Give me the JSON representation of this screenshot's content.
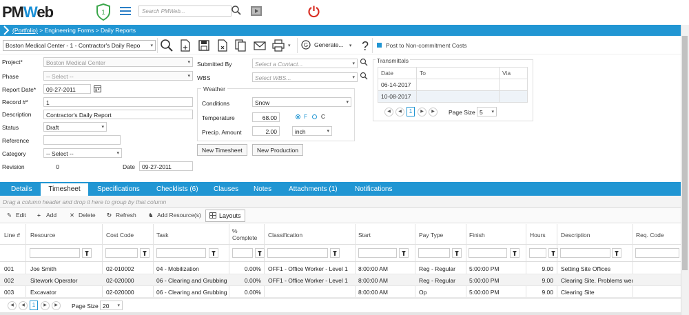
{
  "header": {
    "logo_main": "PM",
    "logo_w": "W",
    "logo_rest": "eb",
    "badge_count": "1",
    "search_placeholder": "Search PMWeb...",
    "colors": {
      "accent": "#2196d3",
      "power": "#d93025"
    }
  },
  "breadcrumb": {
    "root": "(Portfolio)",
    "path": " > Engineering Forms > Daily Reports"
  },
  "toolbar": {
    "project_selected": "Boston Medical Center - 1 - Contractor's Daily Repo",
    "generate_label": "Generate...",
    "post_label": "Post to Non-commitment Costs",
    "icons": [
      "search-icon",
      "new-icon",
      "save-icon",
      "delete-icon",
      "copy-icon",
      "email-icon",
      "print-icon",
      "generate-icon",
      "help-icon"
    ]
  },
  "form": {
    "project_label": "Project*",
    "project_value": "Boston Medical Center",
    "phase_label": "Phase",
    "phase_value": "-- Select --",
    "report_date_label": "Report Date*",
    "report_date_value": "09-27-2011",
    "record_label": "Record #*",
    "record_value": "1",
    "description_label": "Description",
    "description_value": "Contractor's Daily Report",
    "status_label": "Status",
    "status_value": "Draft",
    "reference_label": "Reference",
    "reference_value": "",
    "category_label": "Category",
    "category_value": "-- Select --",
    "revision_label": "Revision",
    "revision_value": "0",
    "date_label": "Date",
    "date_value": "09-27-2011",
    "submitted_by_label": "Submitted By",
    "submitted_by_placeholder": "Select a Contact...",
    "wbs_label": "WBS",
    "wbs_placeholder": "Select WBS..."
  },
  "weather": {
    "title": "Weather",
    "conditions_label": "Conditions",
    "conditions_value": "Snow",
    "temperature_label": "Temperature",
    "temperature_value": "68.00",
    "unit_f": "F",
    "unit_c": "C",
    "precip_label": "Precip. Amount",
    "precip_value": "2.00",
    "precip_unit": "inch"
  },
  "buttons": {
    "new_timesheet": "New Timesheet",
    "new_production": "New Production"
  },
  "transmittals": {
    "title": "Transmittals",
    "columns": [
      "Date",
      "To",
      "Via"
    ],
    "rows": [
      {
        "date": "06-14-2017",
        "to": "",
        "via": ""
      },
      {
        "date": "10-08-2017",
        "to": "",
        "via": ""
      }
    ],
    "page": "1",
    "page_size_label": "Page Size",
    "page_size_value": "5"
  },
  "tabs": [
    {
      "label": "Details"
    },
    {
      "label": "Timesheet"
    },
    {
      "label": "Specifications"
    },
    {
      "label": "Checklists (6)"
    },
    {
      "label": "Clauses"
    },
    {
      "label": "Notes"
    },
    {
      "label": "Attachments (1)"
    },
    {
      "label": "Notifications"
    }
  ],
  "grid": {
    "group_hint": "Drag a column header and drop it here to group by that column",
    "tools": {
      "edit": "Edit",
      "add": "Add",
      "delete": "Delete",
      "refresh": "Refresh",
      "add_resources": "Add Resource(s)",
      "layouts": "Layouts"
    },
    "columns": {
      "line": "Line #",
      "resource": "Resource",
      "cost_code": "Cost Code",
      "task": "Task",
      "pct_line1": "%",
      "pct_line2": "Complete",
      "classification": "Classification",
      "start": "Start",
      "pay_type": "Pay Type",
      "finish": "Finish",
      "hours": "Hours",
      "description": "Description",
      "req_code": "Req. Code"
    },
    "rows": [
      {
        "line": "001",
        "resource": "Joe Smith",
        "cost_code": "02-010002",
        "task": "04 - Mobilization",
        "pct": "0.00%",
        "classification": "OFF1 - Office Worker - Level 1",
        "start": "8:00:00 AM",
        "pay_type": "Reg - Regular",
        "finish": "5:00:00 PM",
        "hours": "9.00",
        "description": "Setting Site Offices"
      },
      {
        "line": "002",
        "resource": "Sitework Operator",
        "cost_code": "02-020000",
        "task": "06 - Clearing and Grubbing",
        "pct": "0.00%",
        "classification": "OFF1 - Office Worker - Level 1",
        "start": "8:00:00 AM",
        "pay_type": "Reg - Regular",
        "finish": "5:00:00 PM",
        "hours": "9.00",
        "description": "Clearing Site. Problems were"
      },
      {
        "line": "003",
        "resource": "Excavator",
        "cost_code": "02-020000",
        "task": "06 - Clearing and Grubbing",
        "pct": "0.00%",
        "classification": "",
        "start": "8:00:00 AM",
        "pay_type": "Op",
        "finish": "5:00:00 PM",
        "hours": "9.00",
        "description": "Clearing Site"
      }
    ],
    "page": "1",
    "page_size_label": "Page Size",
    "page_size_value": "20"
  }
}
